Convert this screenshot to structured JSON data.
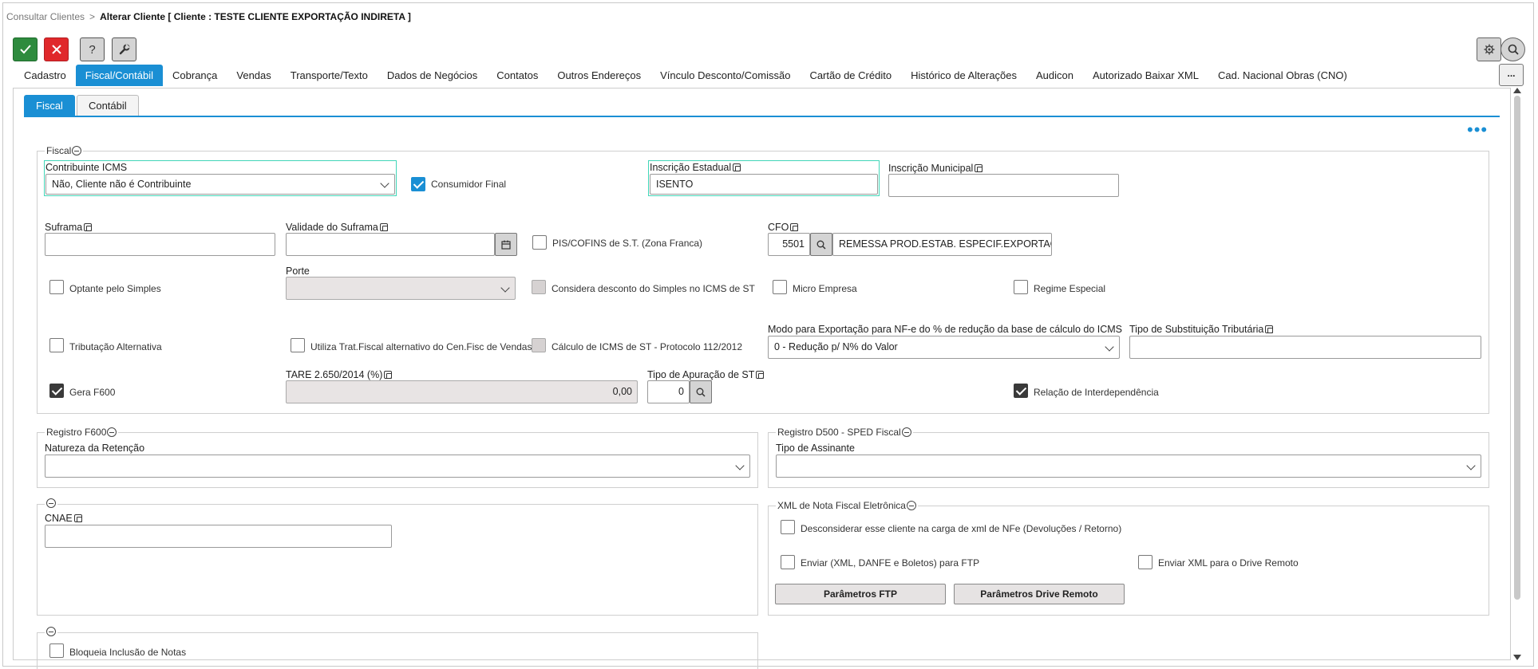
{
  "breadcrumb": {
    "parent": "Consultar Clientes",
    "separator": ">",
    "current": "Alterar Cliente [ Cliente : TESTE CLIENTE EXPORTAÇÃO INDIRETA ]"
  },
  "toolbar": {
    "confirm_icon": "check-icon",
    "cancel_icon": "close-icon",
    "help_label": "?",
    "tool_icon": "wrench-icon",
    "settings_icon": "gear-icon",
    "search_icon": "search-icon",
    "more_label": "..."
  },
  "tabs": [
    {
      "label": "Cadastro"
    },
    {
      "label": "Fiscal/Contábil",
      "active": true
    },
    {
      "label": "Cobrança"
    },
    {
      "label": "Vendas"
    },
    {
      "label": "Transporte/Texto"
    },
    {
      "label": "Dados de Negócios"
    },
    {
      "label": "Contatos"
    },
    {
      "label": "Outros Endereços"
    },
    {
      "label": "Vínculo Desconto/Comissão"
    },
    {
      "label": "Cartão de Crédito"
    },
    {
      "label": "Histórico de Alterações"
    },
    {
      "label": "Audicon"
    },
    {
      "label": "Autorizado Baixar XML"
    },
    {
      "label": "Cad. Nacional Obras (CNO)"
    }
  ],
  "subtabs": [
    {
      "label": "Fiscal",
      "active": true
    },
    {
      "label": "Contábil"
    }
  ],
  "fiscal": {
    "legend": "Fiscal",
    "contribuinte_label": "Contribuinte ICMS",
    "contribuinte_value": "Não, Cliente não é Contribuinte",
    "consumidor_final": "Consumidor Final",
    "consumidor_final_checked": true,
    "inscricao_estadual_label": "Inscrição Estadual",
    "inscricao_estadual_value": "ISENTO",
    "inscricao_municipal_label": "Inscrição Municipal",
    "inscricao_municipal_value": "",
    "suframa_label": "Suframa",
    "suframa_value": "",
    "validade_suframa_label": "Validade do Suframa",
    "validade_suframa_value": "",
    "pis_cofins": "PIS/COFINS de S.T. (Zona Franca)",
    "cfo_label": "CFO",
    "cfo_code": "5501",
    "cfo_desc": "REMESSA PROD.ESTAB. ESPECIF.EXPORTACAO",
    "porte_label": "Porte",
    "porte_value": "",
    "optante_simples": "Optante pelo Simples",
    "considera_desconto": "Considera desconto do Simples no ICMS de ST",
    "micro_empresa": "Micro Empresa",
    "regime_especial": "Regime Especial",
    "tributacao_alternativa": "Tributação Alternativa",
    "utiliza_trat": "Utiliza Trat.Fiscal alternativo do Cen.Fisc de Vendas",
    "calculo_icms": "Cálculo de ICMS de ST - Protocolo 112/2012",
    "modo_exportacao_label": "Modo para Exportação para NF-e do % de redução da base de cálculo do ICMS",
    "modo_exportacao_value": "0 - Redução p/ N% do Valor",
    "tipo_subst_label": "Tipo de Substituição Tributária",
    "tipo_subst_value": "",
    "gera_f600": "Gera F600",
    "gera_f600_checked": true,
    "tare_label": "TARE 2.650/2014 (%)",
    "tare_value": "0,00",
    "tipo_apuracao_label": "Tipo de Apuração de ST",
    "tipo_apuracao_value": "0",
    "relacao_interdependencia": "Relação de Interdependência",
    "relacao_interdependencia_checked": true
  },
  "registro_f600": {
    "legend": "Registro F600",
    "natureza_label": "Natureza da Retenção",
    "natureza_value": ""
  },
  "registro_d500": {
    "legend": "Registro D500 - SPED Fiscal",
    "tipo_assinante_label": "Tipo de Assinante",
    "tipo_assinante_value": ""
  },
  "cnae": {
    "label": "CNAE",
    "value": ""
  },
  "xml_nfe": {
    "legend": "XML de Nota Fiscal Eletrônica",
    "desconsiderar": "Desconsiderar esse cliente na carga de xml de NFe (Devoluções / Retorno)",
    "enviar_ftp": "Enviar (XML, DANFE e Boletos) para FTP",
    "enviar_drive": "Enviar XML para o Drive Remoto",
    "parametros_ftp": "Parâmetros FTP",
    "parametros_drive": "Parâmetros Drive Remoto"
  },
  "notas": {
    "bloqueia_inclusao": "Bloqueia Inclusão de Notas"
  },
  "colors": {
    "accent": "#1a8fd4",
    "confirm": "#2e8b3e",
    "cancel": "#e0282b",
    "highlight": "#41d6b8"
  }
}
